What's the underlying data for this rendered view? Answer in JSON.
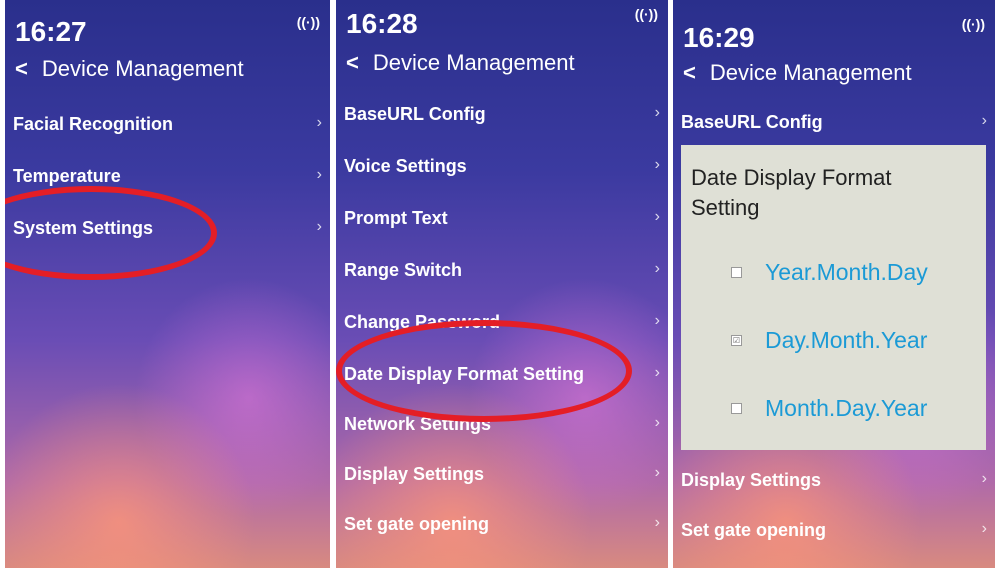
{
  "screens": [
    {
      "time": "16:27",
      "signal_icon": "((·))",
      "header": {
        "back": "<",
        "title": "Device Management"
      },
      "items": [
        {
          "label": "Facial Recognition",
          "chevron": "›"
        },
        {
          "label": "Temperature",
          "chevron": "›"
        },
        {
          "label": "System Settings",
          "chevron": "›"
        }
      ]
    },
    {
      "time": "16:28",
      "signal_icon": "((·))",
      "header": {
        "back": "<",
        "title": "Device Management"
      },
      "items": [
        {
          "label": "BaseURL Config",
          "chevron": "›"
        },
        {
          "label": "Voice Settings",
          "chevron": "›"
        },
        {
          "label": "Prompt Text",
          "chevron": "›"
        },
        {
          "label": "Range Switch",
          "chevron": "›"
        },
        {
          "label": "Change Password",
          "chevron": "›"
        },
        {
          "label": "Date Display Format Setting",
          "chevron": "›"
        },
        {
          "label": "Network Settings",
          "chevron": "›"
        },
        {
          "label": "Display Settings",
          "chevron": "›"
        },
        {
          "label": "Set gate opening",
          "chevron": "›"
        }
      ]
    },
    {
      "time": "16:29",
      "signal_icon": "((·))",
      "header": {
        "back": "<",
        "title": "Device Management"
      },
      "items": [
        {
          "label": "BaseURL Config",
          "chevron": "›"
        },
        {
          "label": "Display Settings",
          "chevron": "›"
        },
        {
          "label": "Set gate opening",
          "chevron": "›"
        }
      ],
      "dialog": {
        "title": "Date Display Format Setting",
        "options": [
          {
            "label": "Year.Month.Day",
            "checked": ""
          },
          {
            "label": "Day.Month.Year",
            "checked": "☑"
          },
          {
            "label": "Month.Day.Year",
            "checked": ""
          }
        ]
      }
    }
  ]
}
